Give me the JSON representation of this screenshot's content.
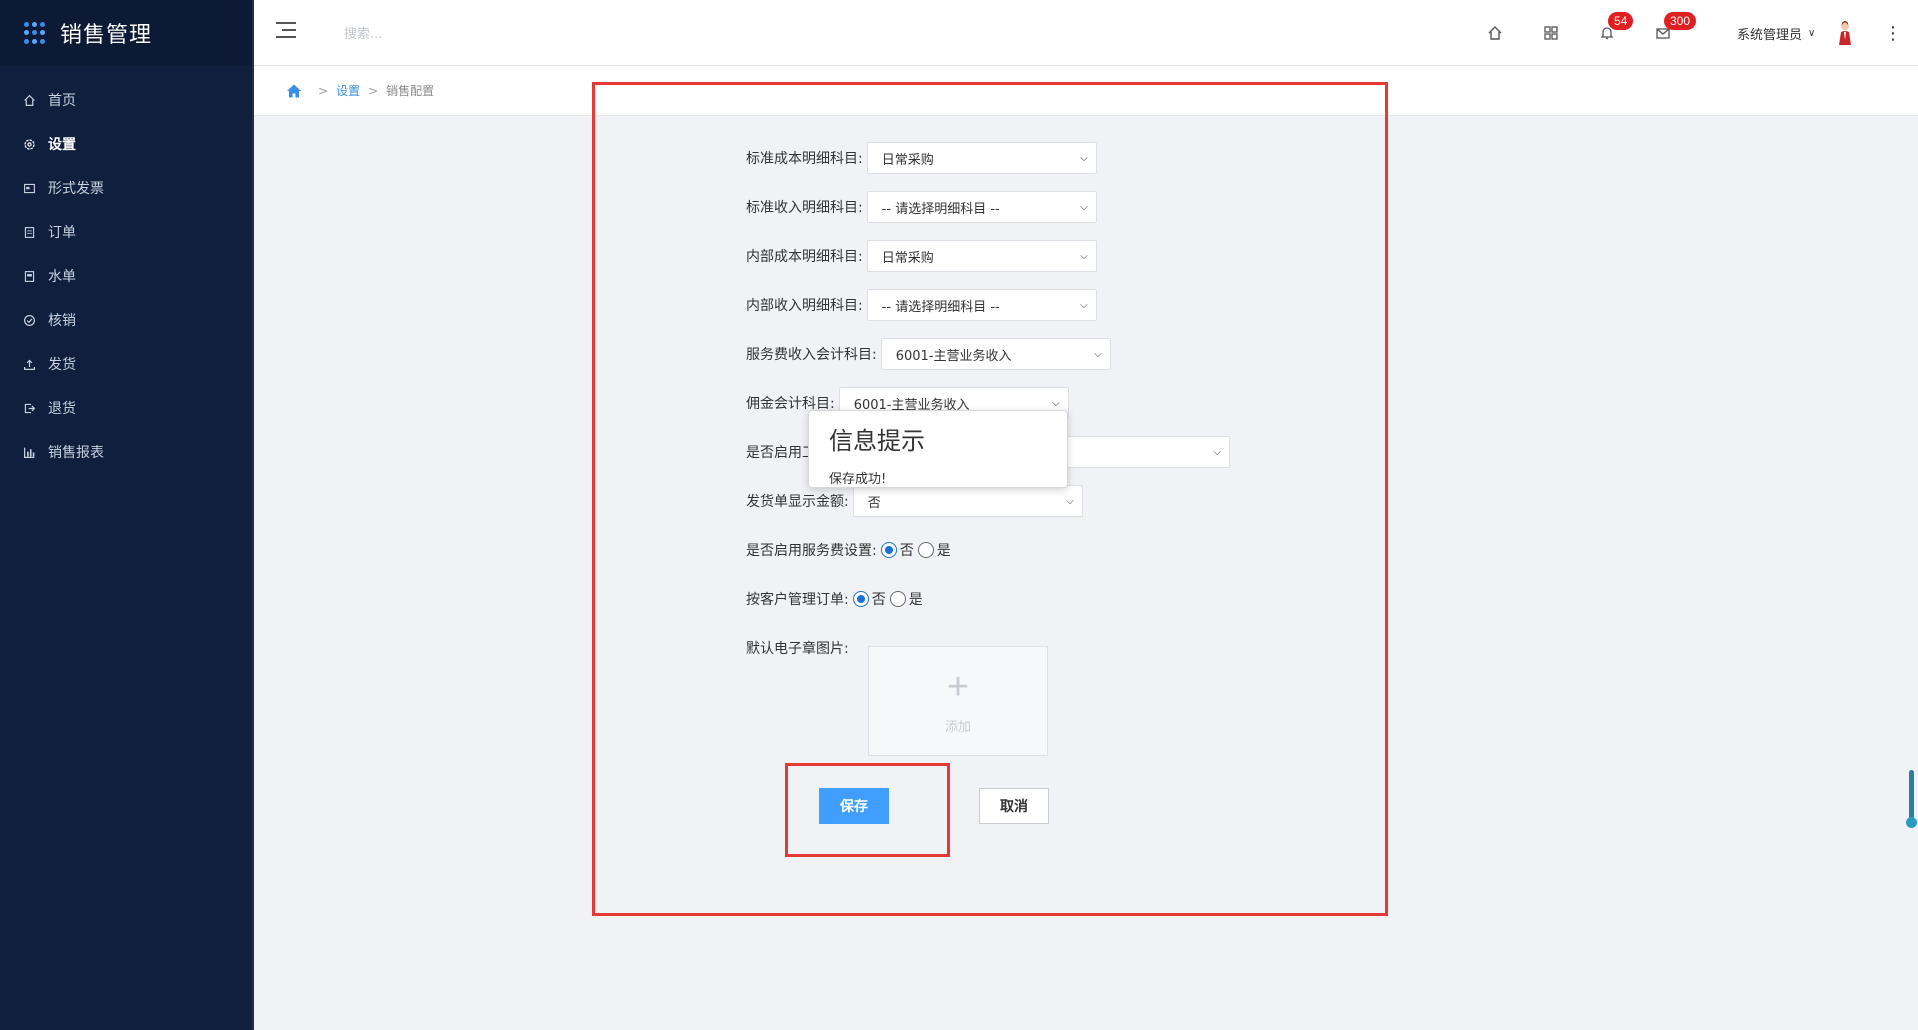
{
  "app": {
    "title": "销售管理"
  },
  "sidebar": {
    "items": [
      {
        "label": "首页",
        "icon": "home-icon"
      },
      {
        "label": "设置",
        "icon": "gear-icon"
      },
      {
        "label": "形式发票",
        "icon": "invoice-icon"
      },
      {
        "label": "订单",
        "icon": "order-icon"
      },
      {
        "label": "水单",
        "icon": "receipt-icon"
      },
      {
        "label": "核销",
        "icon": "check-circle-icon"
      },
      {
        "label": "发货",
        "icon": "upload-icon"
      },
      {
        "label": "退货",
        "icon": "return-icon"
      },
      {
        "label": "销售报表",
        "icon": "bar-chart-icon"
      }
    ],
    "active_index": 1
  },
  "header": {
    "search_placeholder": "搜索...",
    "notifications_count": "54",
    "messages_count": "300",
    "user_name": "系统管理员"
  },
  "breadcrumb": {
    "items": [
      "设置",
      "销售配置"
    ],
    "separator": ">"
  },
  "form": {
    "std_cost_label": "标准成本明细科目:",
    "std_cost_value": "日常采购",
    "std_income_label": "标准收入明细科目:",
    "std_income_value": "-- 请选择明细科目 --",
    "int_cost_label": "内部成本明细科目:",
    "int_cost_value": "日常采购",
    "int_income_label": "内部收入明细科目:",
    "int_income_value": "-- 请选择明细科目 --",
    "service_income_label": "服务费收入会计科目:",
    "service_income_value": "6001-主营业务收入",
    "commission_label": "佣金会计科目:",
    "commission_value": "6001-主营业务收入",
    "enable_label": "是否启用工",
    "ship_amount_label": "发货单显示金额:",
    "ship_amount_value": "否",
    "enable_service_label": "是否启用服务费设置:",
    "enable_service_selected": "否",
    "by_customer_label": "按客户管理订单:",
    "by_customer_selected": "否",
    "radio_no": "否",
    "radio_yes": "是",
    "seal_label": "默认电子章图片:",
    "upload_label": "添加"
  },
  "buttons": {
    "save": "保存",
    "cancel": "取消"
  },
  "toast": {
    "title": "信息提示",
    "message": "保存成功!"
  },
  "colors": {
    "sidebar_bg": "#0f1f3d",
    "primary": "#409eff",
    "highlight": "#e53935",
    "badge": "#e02020"
  }
}
